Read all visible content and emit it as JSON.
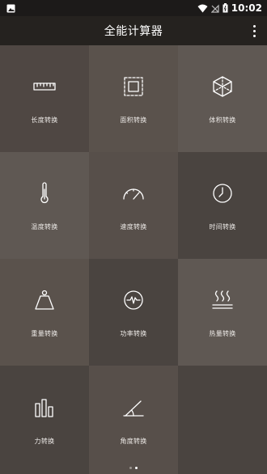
{
  "status": {
    "time": "10:02"
  },
  "appbar": {
    "title": "全能计算器"
  },
  "colors": {
    "tile_a": "#574f4a",
    "tile_b": "#4a4440",
    "tile_c": "#5f5853"
  },
  "tiles": [
    {
      "label": "长度转换",
      "icon": "ruler-icon"
    },
    {
      "label": "面积转换",
      "icon": "area-square-icon"
    },
    {
      "label": "体积转换",
      "icon": "cube-icon"
    },
    {
      "label": "温度转换",
      "icon": "thermometer-icon"
    },
    {
      "label": "速度转换",
      "icon": "speedometer-icon"
    },
    {
      "label": "时间转换",
      "icon": "clock-icon"
    },
    {
      "label": "重量转换",
      "icon": "weight-icon"
    },
    {
      "label": "功率转换",
      "icon": "power-wave-icon"
    },
    {
      "label": "热量转换",
      "icon": "heat-icon"
    },
    {
      "label": "力转换",
      "icon": "bar-chart-icon"
    },
    {
      "label": "角度转换",
      "icon": "angle-icon"
    }
  ],
  "pager": {
    "pages": 2,
    "current": 2
  }
}
